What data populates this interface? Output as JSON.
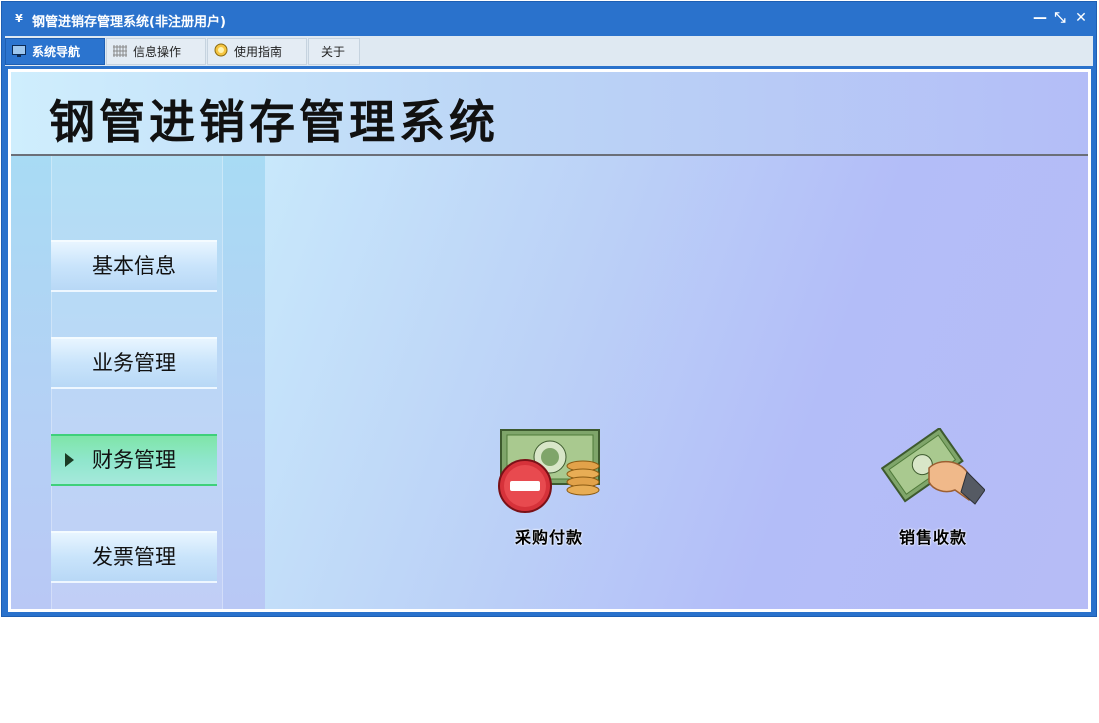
{
  "window": {
    "title": "钢管进销存管理系统(非注册用户)",
    "app_icon": "app-logo-icon"
  },
  "titlebar_buttons": {
    "minimize": "—",
    "restore": "⤡",
    "close": "✕"
  },
  "tabs": [
    {
      "label": "系统导航",
      "icon": "monitor-icon",
      "active": true
    },
    {
      "label": "信息操作",
      "icon": "grid-icon",
      "active": false
    },
    {
      "label": "使用指南",
      "icon": "lightbulb-icon",
      "active": false
    },
    {
      "label": "关于",
      "icon": "",
      "active": false
    }
  ],
  "header": {
    "title": "钢管进销存管理系统"
  },
  "sidebar": {
    "items": [
      {
        "label": "基本信息",
        "active": false
      },
      {
        "label": "业务管理",
        "active": false
      },
      {
        "label": "财务管理",
        "active": true
      },
      {
        "label": "发票管理",
        "active": false
      }
    ]
  },
  "main": {
    "functions": [
      {
        "label": "采购付款",
        "icon": "cash-payment-icon"
      },
      {
        "label": "销售收款",
        "icon": "cash-receipt-icon"
      }
    ]
  },
  "colors": {
    "titlebar": "#2a72cc",
    "active_nav": "#7fe5a8"
  }
}
